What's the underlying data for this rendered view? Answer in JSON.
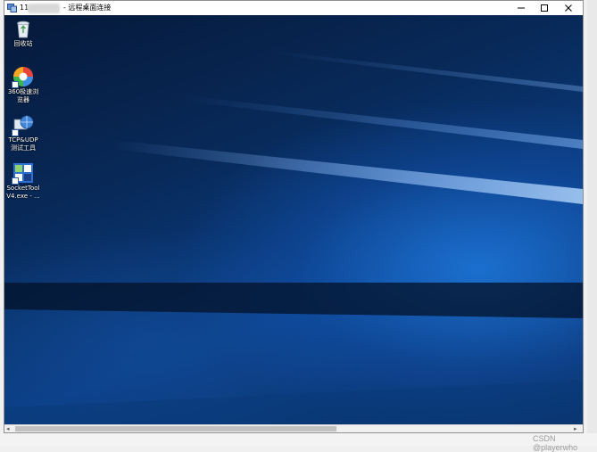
{
  "window": {
    "title_prefix": "11.",
    "title_text": "- 远程桌面连接",
    "minimize_glyph": "—",
    "maximize_glyph": "☐",
    "close_glyph": "✕"
  },
  "desktop": {
    "icons": [
      {
        "label": "回收站",
        "icon": "recycle-bin-icon",
        "shortcut": false
      },
      {
        "label": "360极速浏览器",
        "icon": "browser-360-icon",
        "shortcut": true
      },
      {
        "label": "TCP&UDP测试工具",
        "icon": "network-tool-icon",
        "shortcut": true
      },
      {
        "label": "SocketTool V4.exe - ...",
        "icon": "socket-tool-icon",
        "shortcut": true
      }
    ]
  },
  "scrollbar": {
    "left_arrow": "◂",
    "right_arrow": "▸"
  },
  "watermark": "CSDN @playerwho",
  "colors": {
    "wallpaper_dark": "#06193a",
    "wallpaper_accent": "#1e78dc",
    "chrome": "#ffffff"
  }
}
